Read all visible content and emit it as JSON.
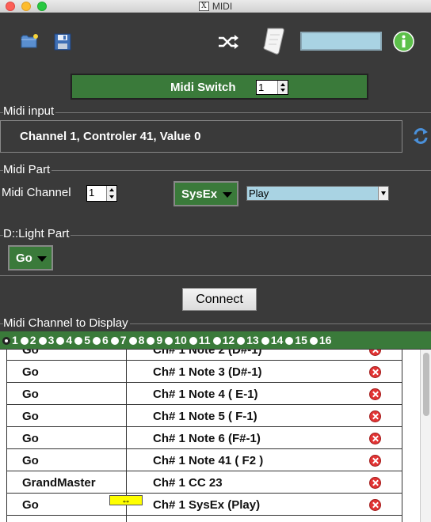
{
  "window": {
    "title": "MIDI"
  },
  "toolbar": {
    "icons": [
      "folder-icon",
      "save-icon",
      "shuffle-icon",
      "scroll-icon",
      "info-icon"
    ],
    "field_value": ""
  },
  "midi_switch": {
    "label": "Midi Switch",
    "value": "1"
  },
  "midi_input": {
    "title": "Midi input",
    "text": "Channel 1, Controler 41, Value 0"
  },
  "midi_part": {
    "title": "Midi Part",
    "channel_label": "Midi Channel",
    "channel_value": "1",
    "type_button": "SysEx",
    "select_value": "Play"
  },
  "dlight_part": {
    "title": "D::Light Part",
    "button": "Go"
  },
  "connect_label": "Connect",
  "channel_display": {
    "title": "Midi Channel to Display",
    "selected": "1",
    "channels": [
      "1",
      "2",
      "3",
      "4",
      "5",
      "6",
      "7",
      "8",
      "9",
      "10",
      "11",
      "12",
      "13",
      "14",
      "15",
      "16"
    ]
  },
  "table": {
    "rows": [
      {
        "action": "Go",
        "event": "Ch# 1 Note 2 (D#-1)"
      },
      {
        "action": "Go",
        "event": "Ch# 1 Note 3 (D#-1)"
      },
      {
        "action": "Go",
        "event": "Ch# 1 Note 4 ( E-1)"
      },
      {
        "action": "Go",
        "event": "Ch# 1 Note 5 ( F-1)"
      },
      {
        "action": "Go",
        "event": "Ch# 1 Note 6 (F#-1)"
      },
      {
        "action": "Go",
        "event": "Ch# 1 Note 41 ( F2 )"
      },
      {
        "action": "GrandMaster",
        "event": "Ch# 1 CC 23"
      },
      {
        "action": "Go",
        "event": "Ch# 1 SysEx (Play)"
      }
    ],
    "drag_glyph": "↔"
  },
  "colors": {
    "background": "#3a3a3a",
    "accent_green": "#3a7a3a",
    "field_blue": "#a9d3e3",
    "delete_red": "#e23434"
  }
}
